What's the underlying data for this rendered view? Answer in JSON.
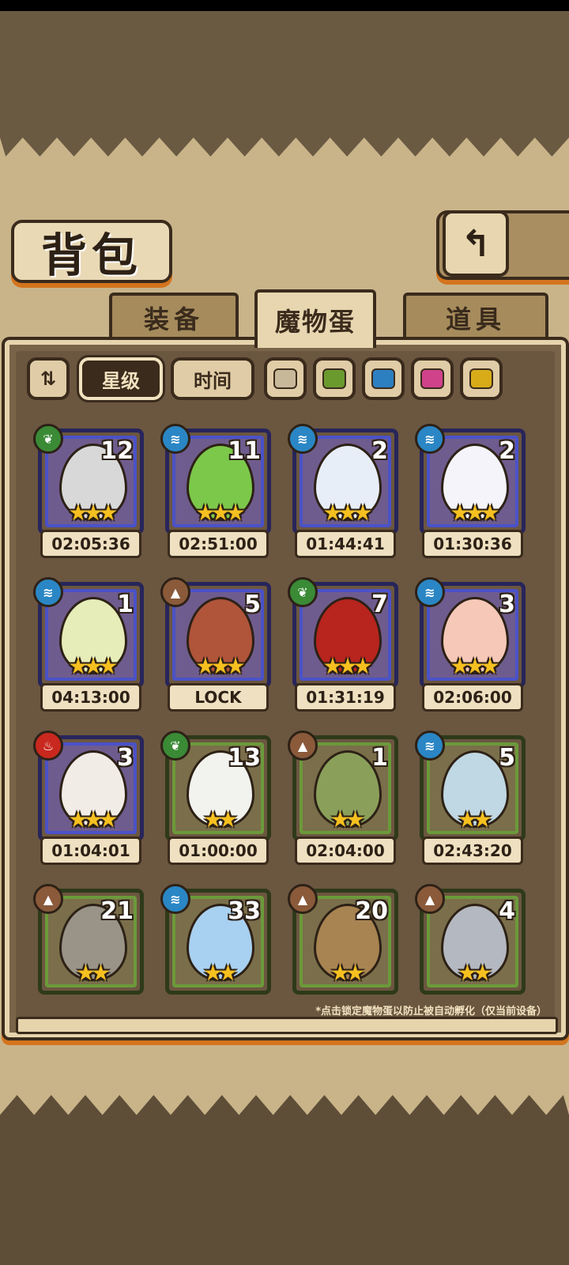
{
  "title": "背包",
  "back_icon": "return-arrow-icon",
  "tabs": [
    {
      "label": "装备",
      "active": false
    },
    {
      "label": "魔物蛋",
      "active": true
    },
    {
      "label": "道具",
      "active": false
    }
  ],
  "filters": {
    "toggle_icon": "sort-toggle-icon",
    "star_label": "星级",
    "time_label": "时间",
    "color_filters": [
      "#c8b89a",
      "#6a9a2e",
      "#2c7fc0",
      "#d0428a",
      "#d8ac18"
    ]
  },
  "eggs": [
    {
      "count": "12",
      "stars": "★★★",
      "timer": "02:05:36",
      "element": "nature",
      "frame": "blue",
      "color": "#d8d8d8"
    },
    {
      "count": "11",
      "stars": "★★★",
      "timer": "02:51:00",
      "element": "water",
      "frame": "blue",
      "color": "#7cc84a"
    },
    {
      "count": "2",
      "stars": "★★★",
      "timer": "01:44:41",
      "element": "water",
      "frame": "blue",
      "color": "#e8eef8"
    },
    {
      "count": "2",
      "stars": "★★★",
      "timer": "01:30:36",
      "element": "water",
      "frame": "blue",
      "color": "#f4f4fa"
    },
    {
      "count": "1",
      "stars": "★★★",
      "timer": "04:13:00",
      "element": "water",
      "frame": "blue",
      "color": "#e6edb8"
    },
    {
      "count": "5",
      "stars": "★★★",
      "timer": "LOCK",
      "element": "earth",
      "frame": "blue",
      "color": "#b0543a"
    },
    {
      "count": "7",
      "stars": "★★★",
      "timer": "01:31:19",
      "element": "nature",
      "frame": "blue",
      "color": "#b8241e"
    },
    {
      "count": "3",
      "stars": "★★★",
      "timer": "02:06:00",
      "element": "water",
      "frame": "blue",
      "color": "#f6c8b8"
    },
    {
      "count": "3",
      "stars": "★★★",
      "timer": "01:04:01",
      "element": "fire",
      "frame": "blue",
      "color": "#f2ece6"
    },
    {
      "count": "13",
      "stars": "★★",
      "timer": "01:00:00",
      "element": "nature",
      "frame": "green",
      "color": "#f2f2ee"
    },
    {
      "count": "1",
      "stars": "★★",
      "timer": "02:04:00",
      "element": "earth",
      "frame": "green",
      "color": "#8aa05a"
    },
    {
      "count": "5",
      "stars": "★★",
      "timer": "02:43:20",
      "element": "water",
      "frame": "green",
      "color": "#c0d8e4"
    },
    {
      "count": "21",
      "stars": "★★",
      "timer": "",
      "element": "earth",
      "frame": "green",
      "color": "#9a9488"
    },
    {
      "count": "33",
      "stars": "★★",
      "timer": "",
      "element": "water",
      "frame": "green",
      "color": "#a8d0f0"
    },
    {
      "count": "20",
      "stars": "★★",
      "timer": "",
      "element": "earth",
      "frame": "green",
      "color": "#a88452"
    },
    {
      "count": "4",
      "stars": "★★",
      "timer": "",
      "element": "earth",
      "frame": "green",
      "color": "#b4b8c0"
    }
  ],
  "element_colors": {
    "nature": "#3a8a36",
    "water": "#2a86c4",
    "earth": "#8a5a3a",
    "fire": "#c8281e"
  },
  "note": "*点击锁定魔物蛋以防止被自动孵化（仅当前设备）"
}
